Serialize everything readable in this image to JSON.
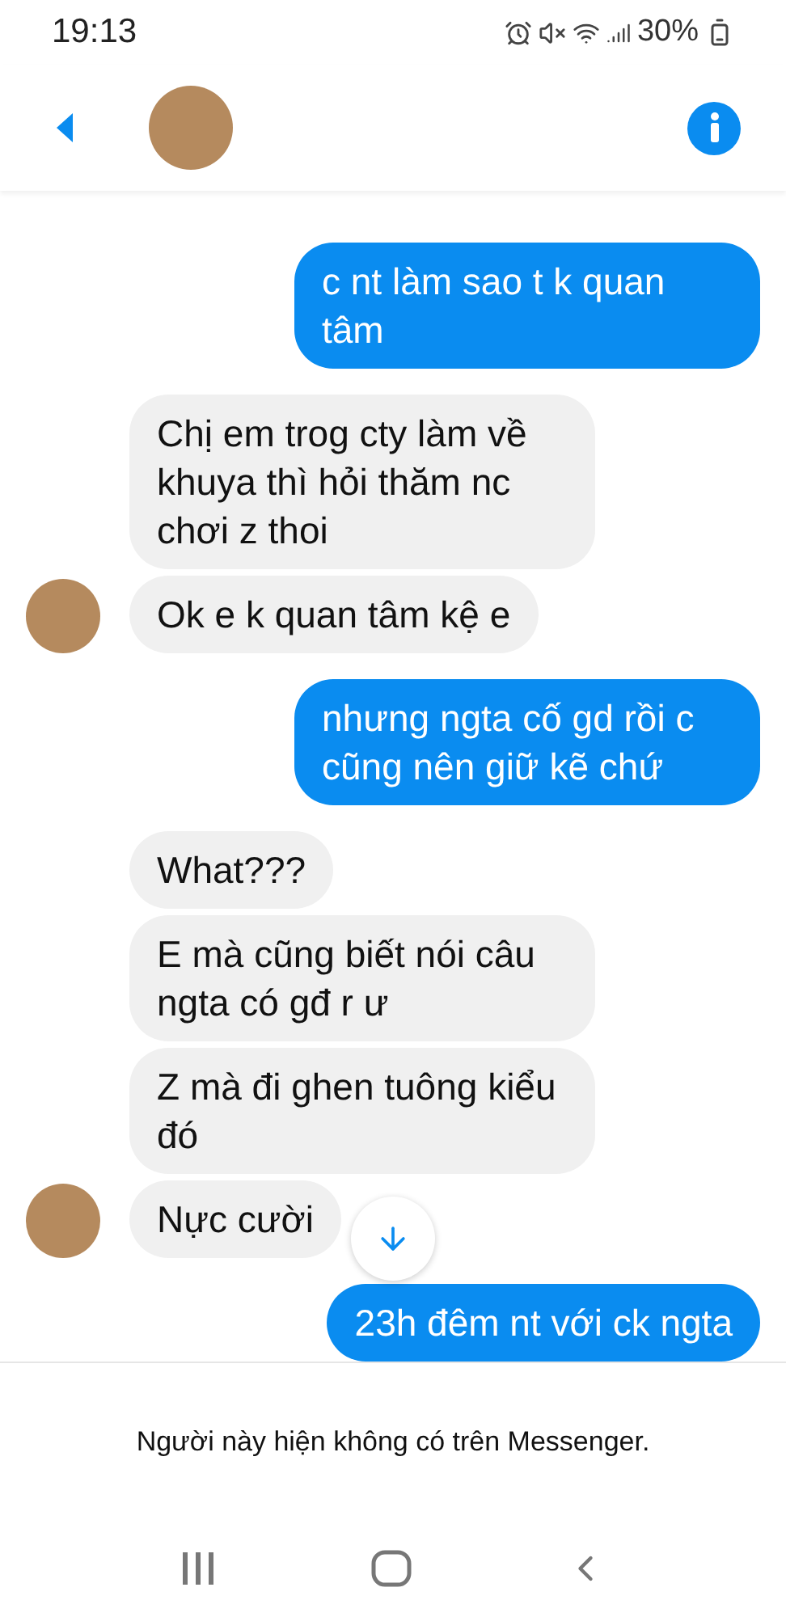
{
  "status_bar": {
    "time": "19:13",
    "battery": "30%"
  },
  "messages": [
    {
      "kind": "sent",
      "text": "c nt làm sao t k quan tâm"
    },
    {
      "kind": "received",
      "text": "Chị em trog cty làm về khuya thì hỏi thăm nc chơi z thoi",
      "avatar": false
    },
    {
      "kind": "received",
      "text": "Ok e k quan tâm kệ e",
      "avatar": true
    },
    {
      "kind": "sent",
      "text": "nhưng ngta cố gd rồi c cũng nên giữ kẽ chứ"
    },
    {
      "kind": "received",
      "text": "What???",
      "avatar": false
    },
    {
      "kind": "received",
      "text": "E mà cũng biết nói câu ngta có gđ r ư",
      "avatar": false
    },
    {
      "kind": "received",
      "text": "Z mà đi ghen tuông kiểu đó",
      "avatar": false
    },
    {
      "kind": "received",
      "text": "Nực cười",
      "avatar": true
    },
    {
      "kind": "sent",
      "text": "23h đêm nt với ck ngta"
    }
  ],
  "notice": "Người này hiện không có trên Messenger."
}
